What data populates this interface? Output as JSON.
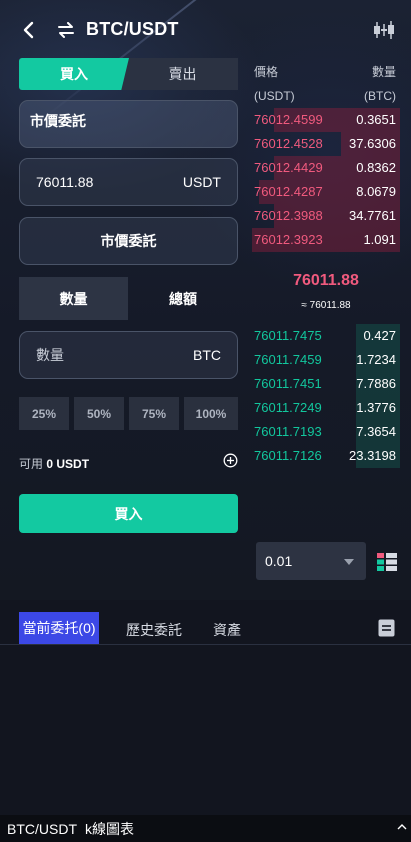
{
  "header": {
    "title": "BTC/USDT"
  },
  "trade_tabs": {
    "buy": "買入",
    "sell": "賣出"
  },
  "order_type": "市價委託",
  "price_field": {
    "value": "76011.88",
    "unit": "USDT"
  },
  "market_button": "市價委託",
  "amount_mode": {
    "quantity": "數量",
    "total": "總額"
  },
  "amount_field": {
    "placeholder": "數量",
    "unit": "BTC"
  },
  "percent_buttons": [
    "25%",
    "50%",
    "75%",
    "100%"
  ],
  "available": {
    "label": "可用",
    "value": "0 USDT"
  },
  "submit_button": "買入",
  "orderbook": {
    "price_header": "價格",
    "price_unit": "(USDT)",
    "qty_header": "數量",
    "qty_unit": "(BTC)",
    "asks": [
      {
        "price": "76012.4599",
        "qty": "0.3651",
        "depth": 0.85
      },
      {
        "price": "76012.4528",
        "qty": "37.6306",
        "depth": 0.4
      },
      {
        "price": "76012.4429",
        "qty": "0.8362",
        "depth": 0.85
      },
      {
        "price": "76012.4287",
        "qty": "8.0679",
        "depth": 0.95
      },
      {
        "price": "76012.3988",
        "qty": "34.7761",
        "depth": 0.85
      },
      {
        "price": "76012.3923",
        "qty": "1.091",
        "depth": 1.0
      }
    ],
    "last_price": "76011.88",
    "last_price_fiat": "≈ 76011.88",
    "bids": [
      {
        "price": "76011.7475",
        "qty": "0.427",
        "depth": 0.3
      },
      {
        "price": "76011.7459",
        "qty": "1.7234",
        "depth": 0.3
      },
      {
        "price": "76011.7451",
        "qty": "7.7886",
        "depth": 0.3
      },
      {
        "price": "76011.7249",
        "qty": "1.3776",
        "depth": 0.3
      },
      {
        "price": "76011.7193",
        "qty": "7.3654",
        "depth": 0.3
      },
      {
        "price": "76011.7126",
        "qty": "23.3198",
        "depth": 0.3
      }
    ],
    "depth_precision": "0.01"
  },
  "orders_tabs": {
    "current": "當前委托(0)",
    "history": "歷史委託",
    "assets": "資產"
  },
  "bottom_bar": {
    "pair": "BTC/USDT",
    "chart_label": "k線圖表"
  },
  "colors": {
    "buy": "#13c9a1",
    "sell": "#f05a7e",
    "active_tab": "#3c48e6",
    "background": "#12151f"
  },
  "icons": [
    "back-icon",
    "swap-icon",
    "candlestick-icon",
    "plus-circle-icon",
    "layout-icon",
    "document-icon",
    "chevron-up-icon"
  ]
}
